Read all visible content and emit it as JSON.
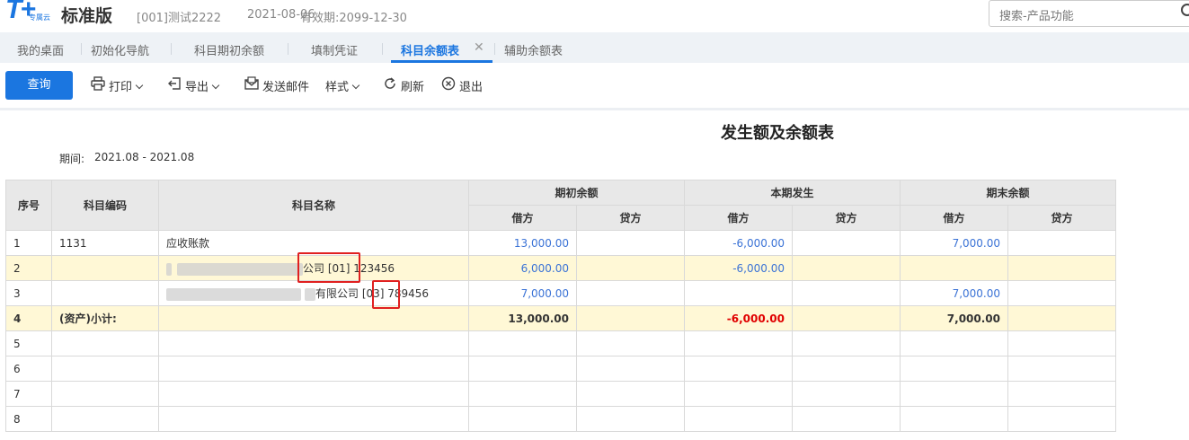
{
  "app": {
    "logo_mark": "T+",
    "logo_sub": "专属云",
    "name": "标准版",
    "account": "[001]测试2222",
    "date": "2021-08-06",
    "expire": "有效期:2099-12-30"
  },
  "search": {
    "placeholder": "搜索-产品功能"
  },
  "tabs": [
    {
      "label": "我的桌面"
    },
    {
      "label": "初始化导航"
    },
    {
      "label": "科目期初余额"
    },
    {
      "label": "填制凭证"
    },
    {
      "label": "科目余额表",
      "active": true
    },
    {
      "label": "辅助余额表"
    }
  ],
  "toolbar": {
    "query": "查询",
    "print": "打印",
    "export": "导出",
    "email": "发送邮件",
    "style": "样式",
    "refresh": "刷新",
    "exit": "退出"
  },
  "report": {
    "title": "发生额及余额表",
    "period_label": "期间:",
    "period_value": "2021.08 - 2021.08",
    "headers": {
      "seq": "序号",
      "code": "科目编码",
      "name": "科目名称",
      "opening": "期初余额",
      "current": "本期发生",
      "closing": "期末余额",
      "debit": "借方",
      "credit": "贷方"
    },
    "rows": [
      {
        "seq": "1",
        "code": "1131",
        "name": "应收账款",
        "od": "13,000.00",
        "oc": "",
        "cd": "-6,000.00",
        "cc": "",
        "ed": "7,000.00",
        "ec": ""
      },
      {
        "seq": "2",
        "code": "",
        "name_visible": "公司 [01] 123456",
        "od": "6,000.00",
        "oc": "",
        "cd": "-6,000.00",
        "cc": "",
        "ed": "",
        "ec": ""
      },
      {
        "seq": "3",
        "code": "",
        "name_visible": "有限公司 [03] 789456",
        "od": "7,000.00",
        "oc": "",
        "cd": "",
        "cc": "",
        "ed": "7,000.00",
        "ec": ""
      },
      {
        "seq": "4",
        "code": "(资产)小计:",
        "name": "",
        "od": "13,000.00",
        "oc": "",
        "cd": "-6,000.00",
        "cc": "",
        "ed": "7,000.00",
        "ec": ""
      },
      {
        "seq": "5"
      },
      {
        "seq": "6"
      },
      {
        "seq": "7"
      },
      {
        "seq": "8"
      }
    ]
  },
  "colors": {
    "accent": "#1b76e0",
    "highlight_row": "#fff8d6",
    "negative": "#e00000",
    "amount": "#3b73d6"
  }
}
